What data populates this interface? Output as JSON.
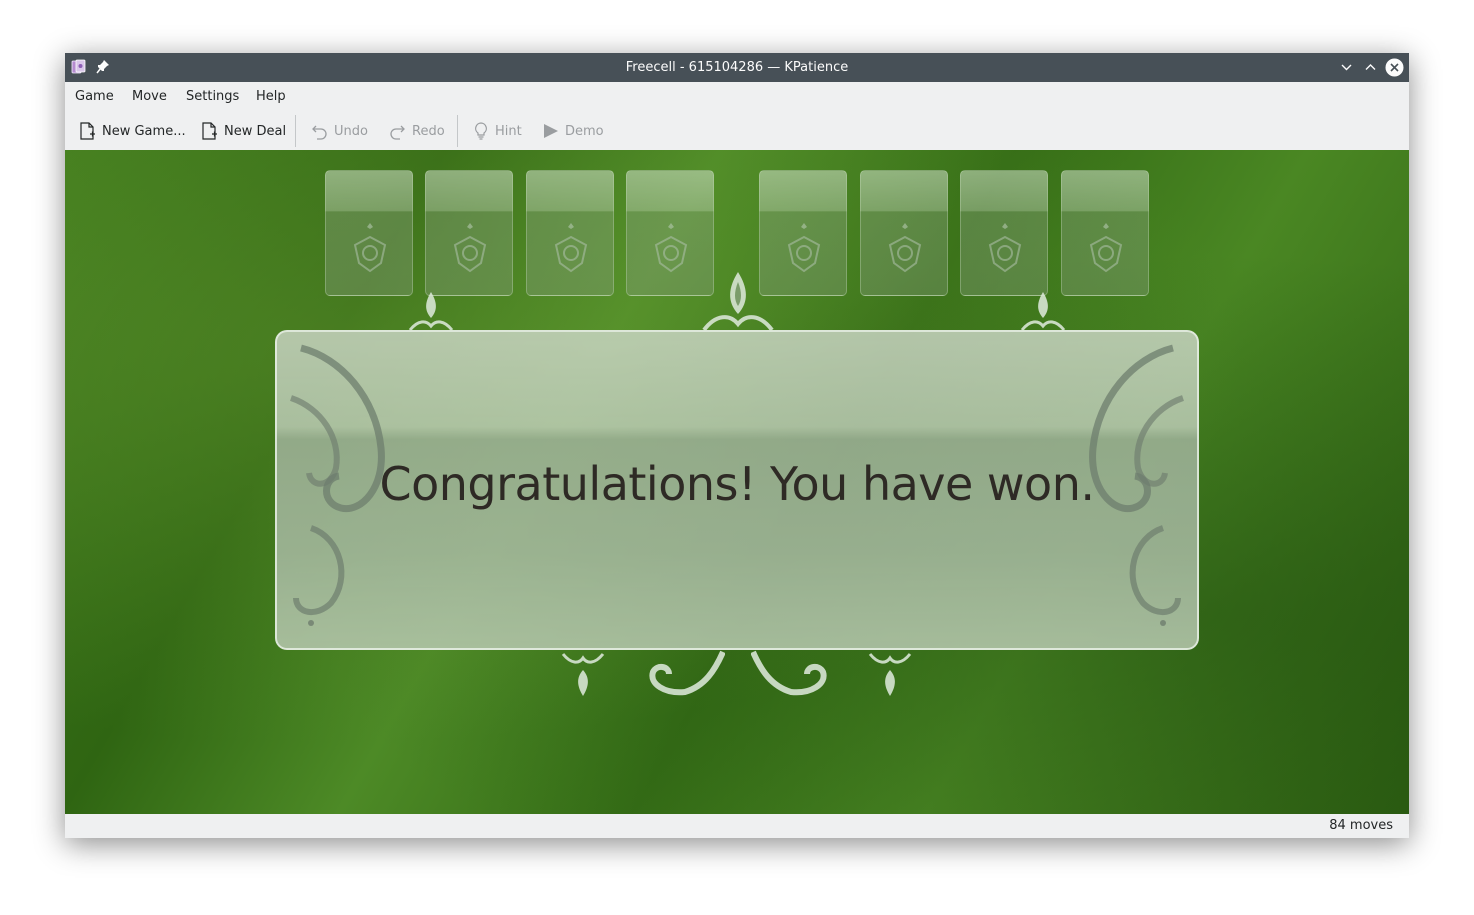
{
  "window": {
    "title": "Freecell - 615104286 — KPatience"
  },
  "menu": {
    "items": [
      "Game",
      "Move",
      "Settings",
      "Help"
    ]
  },
  "toolbar": {
    "new_game": "New Game...",
    "new_deal": "New Deal",
    "undo": "Undo",
    "redo": "Redo",
    "hint": "Hint",
    "demo": "Demo"
  },
  "board": {
    "message": "Congratulations! You have won.",
    "freecells": 4,
    "foundations": 4
  },
  "status": {
    "moves": "84 moves"
  },
  "colors": {
    "titlebar": "#475057",
    "felt": "#3f7a1c",
    "text": "#232627"
  }
}
